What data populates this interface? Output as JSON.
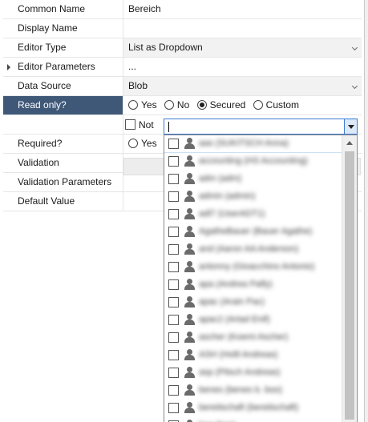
{
  "properties": [
    {
      "name": "Common Name",
      "value": "Bereich"
    },
    {
      "name": "Display Name",
      "value": ""
    },
    {
      "name": "Editor Type",
      "value": "List as Dropdown"
    },
    {
      "name": "Editor Parameters",
      "value": "..."
    },
    {
      "name": "Data Source",
      "value": "Blob"
    },
    {
      "name": "Read only?",
      "value": ""
    },
    {
      "name": "",
      "value": ""
    },
    {
      "name": "Required?",
      "value": ""
    },
    {
      "name": "Validation",
      "value": ""
    },
    {
      "name": "Validation Parameters",
      "value": ""
    },
    {
      "name": "Default Value",
      "value": ""
    }
  ],
  "readonly_options": [
    "Yes",
    "No",
    "Secured",
    "Custom"
  ],
  "readonly_selected": "Secured",
  "not_label": "Not",
  "required_options": [
    "Yes"
  ],
  "combo": {
    "value": ""
  },
  "dropdown_items": [
    "aas (SUKITSCH Anna)",
    "accounting (HS Accounting)",
    "adm (adm)",
    "admin (admin)",
    "adl7 (UserADT1)",
    "AgatheBauer (Bauer Agathe)",
    "and (Aaron AA Anderson)",
    "antonny (Gioacchino Antonio)",
    "apa (Andrea Palfy)",
    "apac (Arain Pac)",
    "apac2 (Artad Enif)",
    "ascher (Koemi Ascher)",
    "ASH (Holtl Andreas)",
    "asp (Pitsch Andreas)",
    "benes (benes b. boo)",
    "bereitschaft (bereitschaft)",
    "bez (bez)"
  ]
}
